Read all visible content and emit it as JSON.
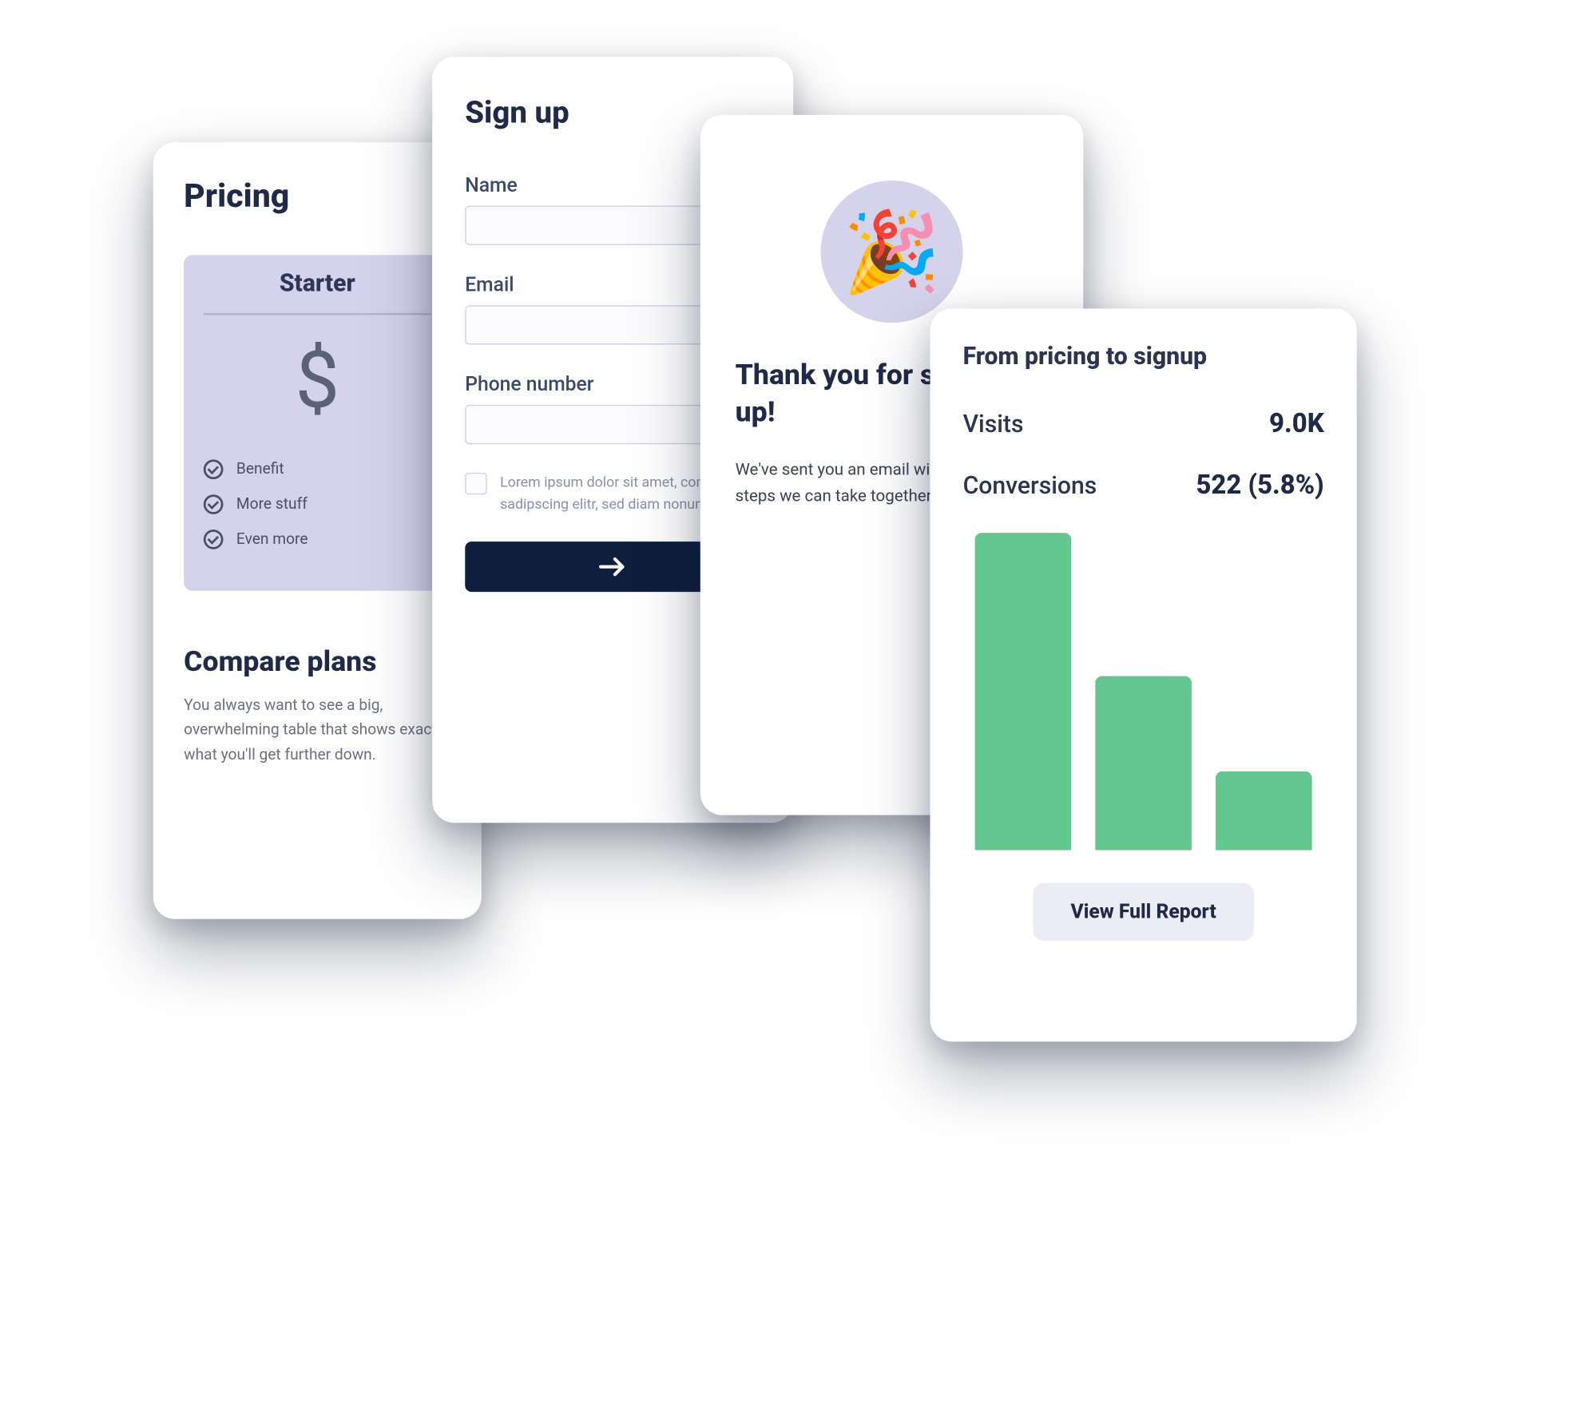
{
  "pricing": {
    "title": "Pricing",
    "plan_name": "Starter",
    "currency_icon": "dollar-icon",
    "benefits": [
      "Benefit",
      "More stuff",
      "Even more"
    ],
    "compare_title": "Compare plans",
    "compare_text": "You always want to see a big, overwhelming table that shows exactly what you'll get further down."
  },
  "signup": {
    "title": "Sign up",
    "fields": [
      {
        "label": "Name"
      },
      {
        "label": "Email"
      },
      {
        "label": "Phone number"
      }
    ],
    "consent_text": "Lorem ipsum dolor sit amet, consetetur sadipscing elitr, sed diam nonumy…",
    "submit_icon": "arrow-right-icon"
  },
  "thanks": {
    "icon": "party-popper-icon",
    "emoji": "🎉",
    "heading": "Thank you for signing up!",
    "body": "We've sent you an email with the first steps we can take together."
  },
  "report": {
    "title": "From pricing to signup",
    "metrics": [
      {
        "label": "Visits",
        "value": "9.0K"
      },
      {
        "label": "Conversions",
        "value": "522 (5.8%)"
      }
    ],
    "button_label": "View Full Report"
  },
  "chart_data": {
    "type": "bar",
    "title": "From pricing to signup",
    "categories": [
      "",
      "",
      ""
    ],
    "values": [
      100,
      55,
      25
    ],
    "ylim": [
      0,
      100
    ],
    "color": "#63c68e",
    "note": "Relative bar heights; axes unlabeled in source"
  }
}
